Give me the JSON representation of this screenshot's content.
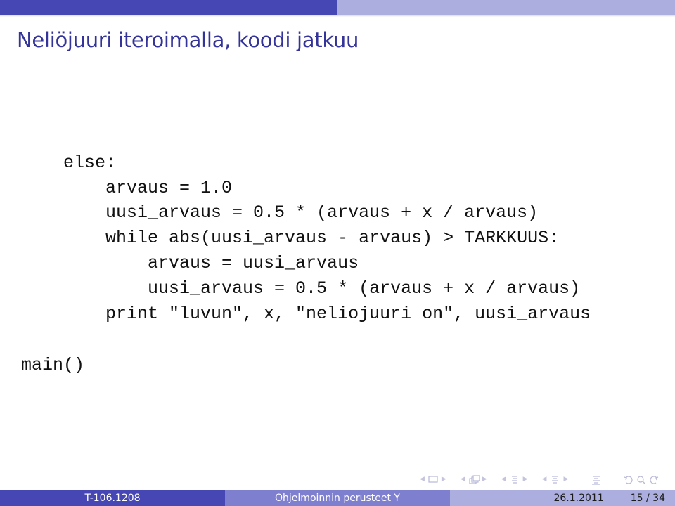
{
  "slide": {
    "title": "Neliöjuuri iteroimalla, koodi jatkuu",
    "code_lines": [
      "else:",
      "    arvaus = 1.0",
      "    uusi_arvaus = 0.5 * (arvaus + x / arvaus)",
      "    while abs(uusi_arvaus - arvaus) > TARKKUUS:",
      "        arvaus = uusi_arvaus",
      "        uusi_arvaus = 0.5 * (arvaus + x / arvaus)",
      "    print \"luvun\", x, \"neliojuuri on\", uusi_arvaus",
      "",
      "main()"
    ]
  },
  "navigation": {
    "icons": [
      "prev-arrow",
      "frame-icon",
      "next-arrow",
      "prev-arrow",
      "subsection-icon",
      "next-arrow",
      "prev-arrow",
      "section-icon",
      "next-arrow",
      "prev-arrow",
      "section-icon",
      "next-arrow",
      "toc-icon",
      "undo-icon",
      "search-icon",
      "redo-icon"
    ]
  },
  "footer": {
    "course_code": "T-106.1208",
    "course_name": "Ohjelmoinnin perusteet Y",
    "date": "26.1.2011",
    "page": "15 / 34"
  },
  "colors": {
    "bar_dark": "#4646b4",
    "bar_medium": "#7f7fcf",
    "bar_light": "#abaede",
    "title": "#33339a"
  }
}
